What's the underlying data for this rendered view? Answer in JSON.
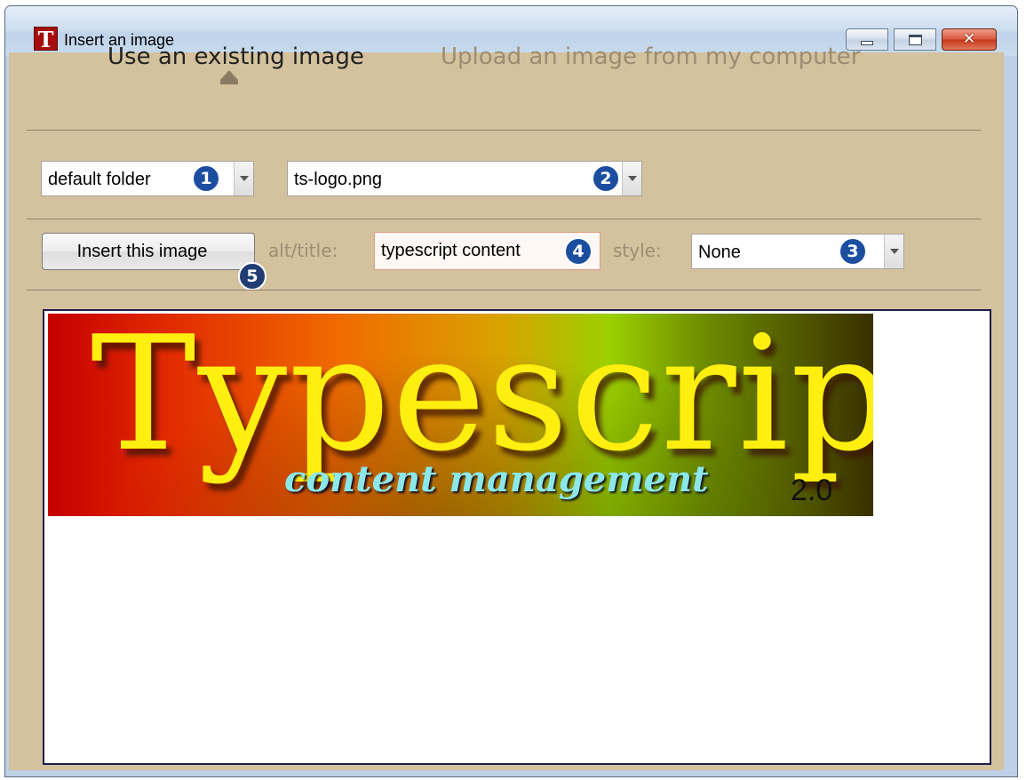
{
  "window": {
    "title": "Insert an image",
    "app_icon_letter": "T",
    "icons": [
      "app-icon",
      "minimize-icon",
      "maximize-icon",
      "close-icon"
    ]
  },
  "tabs": [
    {
      "label": "Use an existing image",
      "active": true
    },
    {
      "label": "Upload an image from my computer",
      "active": false
    }
  ],
  "folder_select": {
    "value": "default folder",
    "badge": "1"
  },
  "file_select": {
    "value": "ts-logo.png",
    "badge": "2"
  },
  "insert_button": {
    "label": "Insert this image",
    "badge": "5"
  },
  "alt_title": {
    "label": "alt/title:",
    "value": "typescript content",
    "badge": "4"
  },
  "style_select": {
    "label": "style:",
    "value": "None",
    "badge": "3"
  },
  "preview": {
    "logo_title": "Typescript",
    "logo_subtitle": "content management",
    "logo_version": "2.0"
  },
  "colors": {
    "client_bg": "#d3c29d",
    "inactive_text": "#9c8d72",
    "badge_blue": "#1c4ea0",
    "logo_yellow": "#ffef10"
  }
}
